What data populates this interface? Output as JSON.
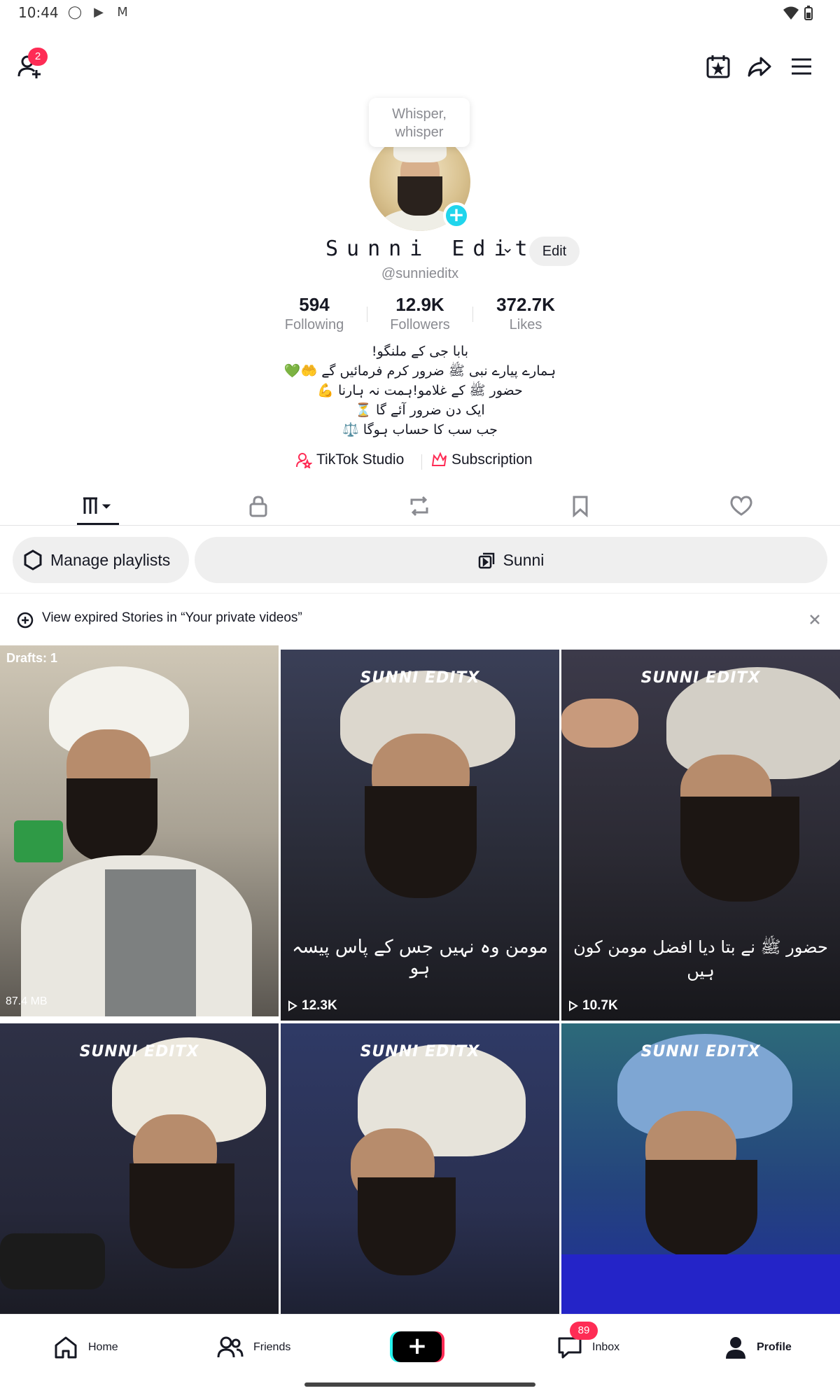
{
  "status_bar": {
    "time": "10:44"
  },
  "header": {
    "friend_requests_badge": "2"
  },
  "profile": {
    "whisper": "Whisper, whisper",
    "display_name": "Sunni Editx",
    "edit_label": "Edit",
    "handle": "@sunnieditx",
    "stats": [
      {
        "value": "594",
        "label": "Following"
      },
      {
        "value": "12.9K",
        "label": "Followers"
      },
      {
        "value": "372.7K",
        "label": "Likes"
      }
    ],
    "bio": [
      "بابا جی کے ملنگو!",
      "ہمارے پیارے نبی ﷺ ضرور کرم فرمائیں گے 🤲💚",
      "حضور ﷺ کے غلامو!ہمت نہ ہارنا 💪",
      "ایک دن ضرور آئے گا ⏳",
      "جب سب کا حساب ہوگا ⚖️"
    ],
    "links": {
      "studio": "TikTok Studio",
      "subscription": "Subscription"
    }
  },
  "pills": {
    "manage": "Manage playlists",
    "playlist": "Sunni"
  },
  "notice": {
    "text": "View expired Stories in “Your private videos”"
  },
  "videos": [
    {
      "drafts": "Drafts: 1",
      "size": "87.4 MB",
      "watermark": "",
      "caption": "",
      "views": ""
    },
    {
      "watermark": "SUNNI EDITX",
      "caption": "مومن وہ نہیں جس کے پاس پیسہ ہو",
      "views": "12.3K"
    },
    {
      "watermark": "SUNNI EDITX",
      "caption": "حضور ﷺ نے بتا دیا افضل مومن کون ہیں",
      "views": "10.7K"
    },
    {
      "watermark": "SUNNI EDITX",
      "caption": "",
      "views": ""
    },
    {
      "watermark": "SUNNI EDITX",
      "caption": "",
      "views": ""
    },
    {
      "watermark": "SUNNI EDITX",
      "caption": "",
      "views": ""
    }
  ],
  "bottom_nav": {
    "home": "Home",
    "friends": "Friends",
    "inbox": "Inbox",
    "inbox_badge": "89",
    "profile": "Profile"
  },
  "colors": {
    "accent": "#fe2c55",
    "cyan": "#20d5ec"
  }
}
